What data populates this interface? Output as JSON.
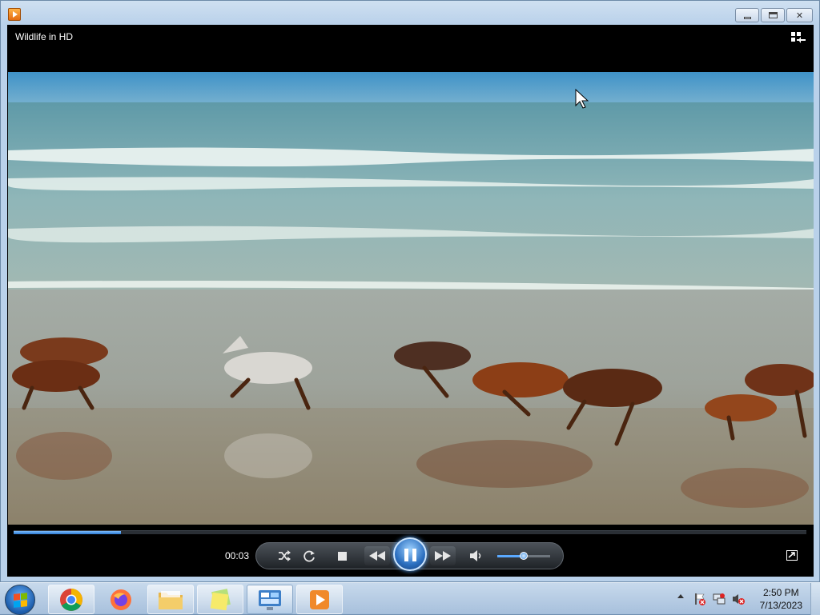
{
  "window": {
    "title_bar_icon": "windows-media-player-icon",
    "controls": [
      "minimize",
      "maximize",
      "close"
    ]
  },
  "player": {
    "video_title": "Wildlife in HD",
    "switch_to_library_icon": "switch-to-library-icon",
    "elapsed_time": "00:03",
    "seek_progress_percent": 13.5,
    "volume_level_percent": 50,
    "buttons": {
      "shuffle": "shuffle-icon",
      "repeat": "repeat-icon",
      "stop": "stop-icon",
      "previous": "rewind-icon",
      "play_pause": "pause-icon",
      "next": "fast-forward-icon",
      "mute": "speaker-icon",
      "fullscreen": "fullscreen-icon"
    },
    "accent_color": "#2b6fc0"
  },
  "taskbar": {
    "start_icon": "windows-start-orb",
    "pinned": [
      {
        "name": "chrome",
        "icon": "chrome-icon"
      },
      {
        "name": "firefox",
        "icon": "firefox-icon"
      },
      {
        "name": "explorer",
        "icon": "folder-icon"
      },
      {
        "name": "notes",
        "icon": "sticky-notes-icon"
      },
      {
        "name": "control-panel",
        "icon": "control-panel-icon"
      },
      {
        "name": "media-player",
        "icon": "media-player-icon"
      }
    ],
    "tray_icons": [
      "action-center-flag-icon",
      "network-icon",
      "volume-muted-icon"
    ],
    "clock_time": "2:50 PM",
    "clock_date": "7/13/2023"
  }
}
